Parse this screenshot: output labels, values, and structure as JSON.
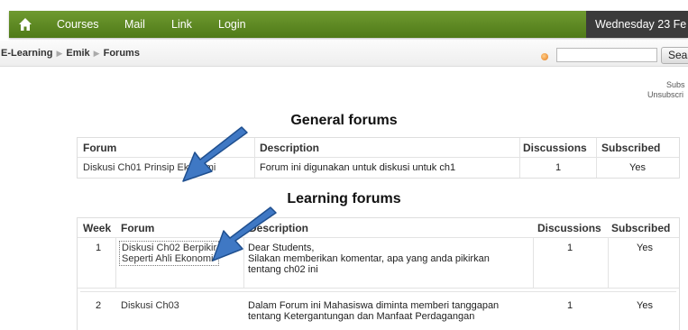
{
  "nav": {
    "items": [
      "Courses",
      "Mail",
      "Link",
      "Login"
    ],
    "date": "Wednesday 23 Fe"
  },
  "breadcrumb": [
    "E-Learning",
    "Emik",
    "Forums"
  ],
  "search": {
    "button_label": "Sea"
  },
  "subscription": {
    "subscribe": "Subs",
    "unsubscribe": "Unsubscri"
  },
  "general_forums": {
    "title": "General forums",
    "headers": [
      "Forum",
      "Description",
      "Discussions",
      "Subscribed"
    ],
    "rows": [
      {
        "forum": "Diskusi Ch01 Prinsip Ekonomi",
        "description": "Forum ini digunakan untuk diskusi untuk ch1",
        "discussions": "1",
        "subscribed": "Yes"
      }
    ]
  },
  "learning_forums": {
    "title": "Learning forums",
    "headers": [
      "Week",
      "Forum",
      "Description",
      "Discussions",
      "Subscribed"
    ],
    "rows": [
      {
        "week": "1",
        "forum_line1": "Diskusi Ch02 Berpikir",
        "forum_line2": "Seperti Ahli Ekonomi",
        "desc_line1": "Dear Students,",
        "desc_line2": "Silakan memberikan komentar, apa yang anda pikirkan",
        "desc_line3": "tentang ch02 ini",
        "discussions": "1",
        "subscribed": "Yes"
      },
      {
        "week": "2",
        "forum": "Diskusi Ch03",
        "desc_line1": "Dalam Forum ini Mahasiswa diminta memberi tanggapan",
        "desc_line2": "tentang Ketergantungan dan Manfaat Perdagangan",
        "discussions": "1",
        "subscribed": "Yes"
      }
    ]
  },
  "colors": {
    "nav_green": "#5e8a22",
    "date_bg": "#3b3b3b",
    "arrow_blue": "#3f78c4"
  }
}
